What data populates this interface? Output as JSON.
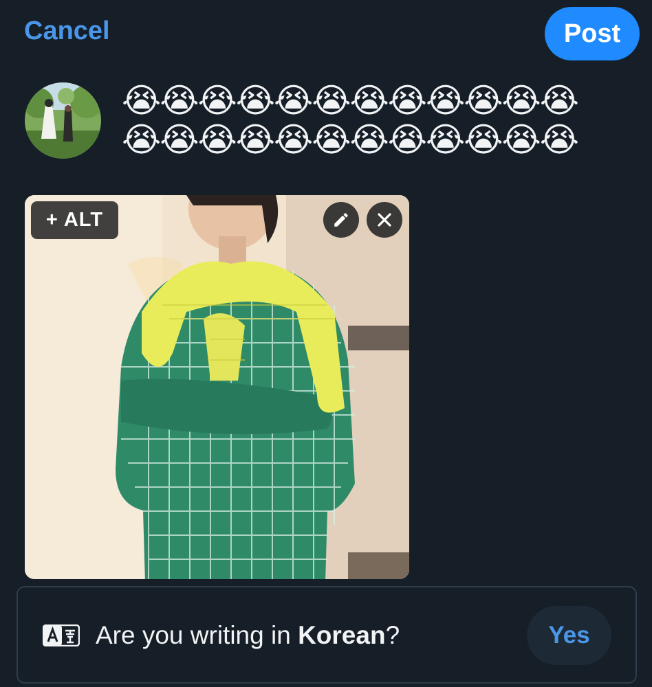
{
  "header": {
    "cancel_label": "Cancel",
    "post_label": "Post"
  },
  "composer": {
    "text": "😭😭😭😭😭😭😭😭😭😭😭😭😭😭😭😭😭😭😭😭😭😭😭😭",
    "avatar_icon": "avatar"
  },
  "media": {
    "alt_label": "+ ALT",
    "edit_icon": "pencil-icon",
    "remove_icon": "close-icon"
  },
  "language_prompt": {
    "prefix": "Are you writing in ",
    "language": "Korean",
    "suffix": "?",
    "yes_label": "Yes",
    "icon": "translate-icon"
  },
  "colors": {
    "background": "#161e27",
    "accent": "#208bfe",
    "link": "#4a97ea"
  }
}
